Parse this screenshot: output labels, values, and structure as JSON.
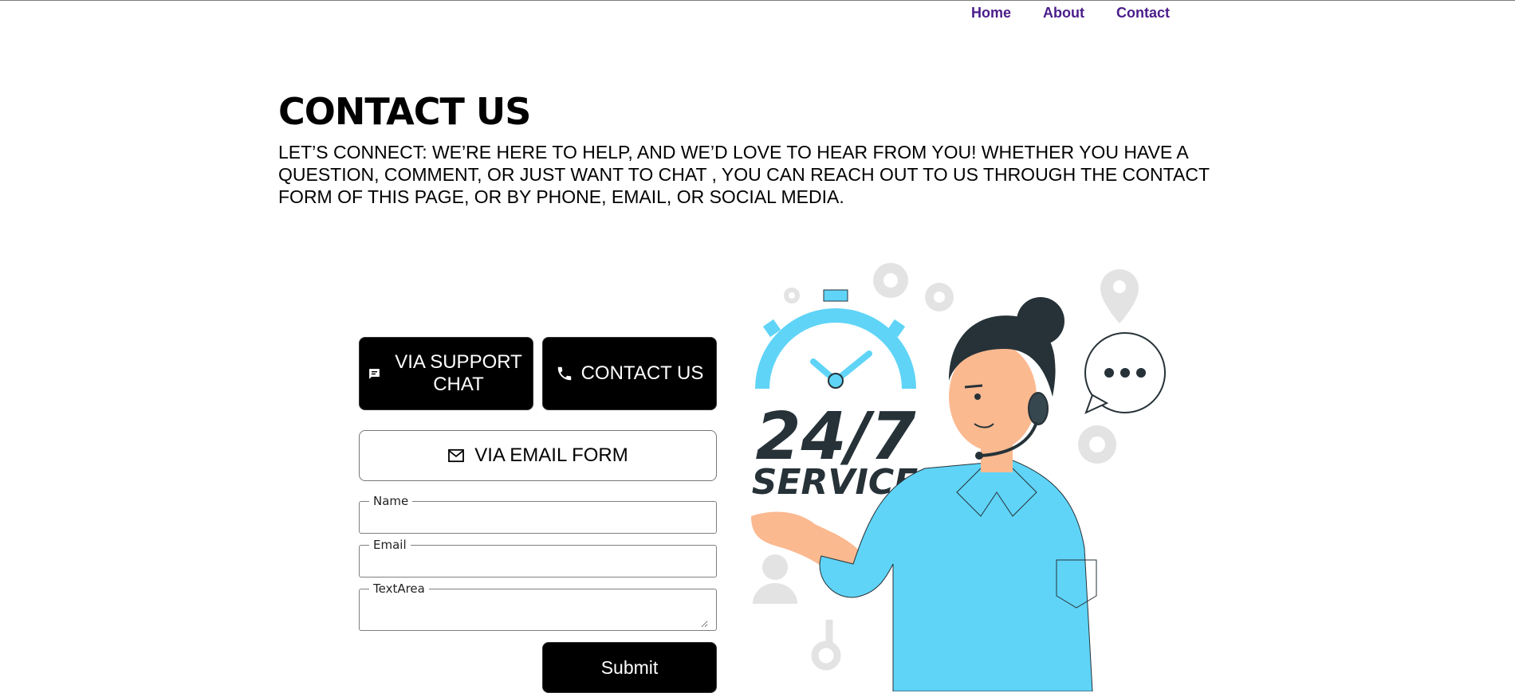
{
  "nav": {
    "links": [
      {
        "label": "Home"
      },
      {
        "label": "About"
      },
      {
        "label": "Contact"
      }
    ]
  },
  "header": {
    "title": "CONTACT US",
    "intro": "LET’S CONNECT: WE’RE HERE TO HELP, AND WE’D LOVE TO HEAR FROM YOU! WHETHER YOU HAVE A QUESTION, COMMENT, OR JUST WANT TO CHAT , YOU CAN REACH OUT TO US THROUGH THE CONTACT FORM OF THIS PAGE, OR BY PHONE, EMAIL, OR SOCIAL MEDIA."
  },
  "buttons": {
    "support_chat": {
      "label": "VIA SUPPORT CHAT",
      "icon": "chat-icon"
    },
    "contact_us": {
      "label": "CONTACT US",
      "icon": "phone-icon"
    },
    "email_form": {
      "label": "VIA EMAIL FORM",
      "icon": "mail-icon"
    },
    "submit": {
      "label": "Submit"
    }
  },
  "form": {
    "name": {
      "label": "Name",
      "value": ""
    },
    "email": {
      "label": "Email",
      "value": ""
    },
    "textarea": {
      "label": "TextArea",
      "value": ""
    }
  },
  "illustration": {
    "big_text": "24/7",
    "sub_text": "SERVICE",
    "icon": "customer-service-agent-illustration"
  },
  "colors": {
    "nav_link": "#4b1d8a",
    "button_dark": "#000000",
    "accent_blue": "#5fd4f7",
    "dark_text": "#263238"
  }
}
